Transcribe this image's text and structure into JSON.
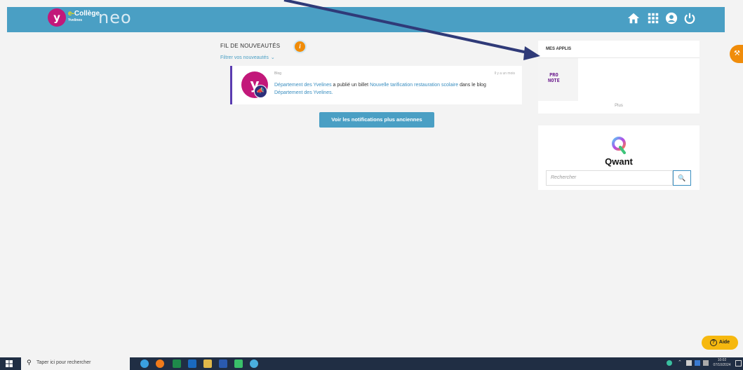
{
  "header": {
    "logo_letter": "y",
    "logo_prefix": "e-",
    "logo_college": "Collège",
    "logo_region": "Yvelines",
    "logo_neo": "neo",
    "icons": [
      "home-icon",
      "apps-grid-icon",
      "user-icon",
      "power-icon"
    ]
  },
  "feed": {
    "title": "FIL DE NOUVEAUTÉS",
    "info_badge": "i",
    "filter_label": "Filtrer vos nouveautés",
    "item": {
      "category": "Blog",
      "time": "Il y a un mois",
      "author": "Département des Yvelines",
      "text_mid": " a publié un billet ",
      "post_title": "Nouvelle tarification restauration scolaire",
      "text_end": " dans le blog",
      "blog_name": "Département des Yvelines",
      "period": "."
    },
    "more_button": "Voir les notifications plus anciennes"
  },
  "apps": {
    "title": "MES APPLIS",
    "pronote_line1": "PRO",
    "pronote_line2": "NOTE",
    "more": "Plus"
  },
  "qwant": {
    "name": "Qwant",
    "search_placeholder": "Rechercher"
  },
  "help": {
    "label": "Aide",
    "icon": "?"
  },
  "taskbar": {
    "search_placeholder": "Taper ici pour rechercher",
    "time": "10:02",
    "date": "07/10/2024"
  },
  "colors": {
    "header_bg": "#4a9fc4",
    "accent_orange": "#f08c0a",
    "brand_magenta": "#c2187a",
    "link_blue": "#3a8ec0",
    "help_yellow": "#f6b80f",
    "arrow": "#2f3a78"
  }
}
